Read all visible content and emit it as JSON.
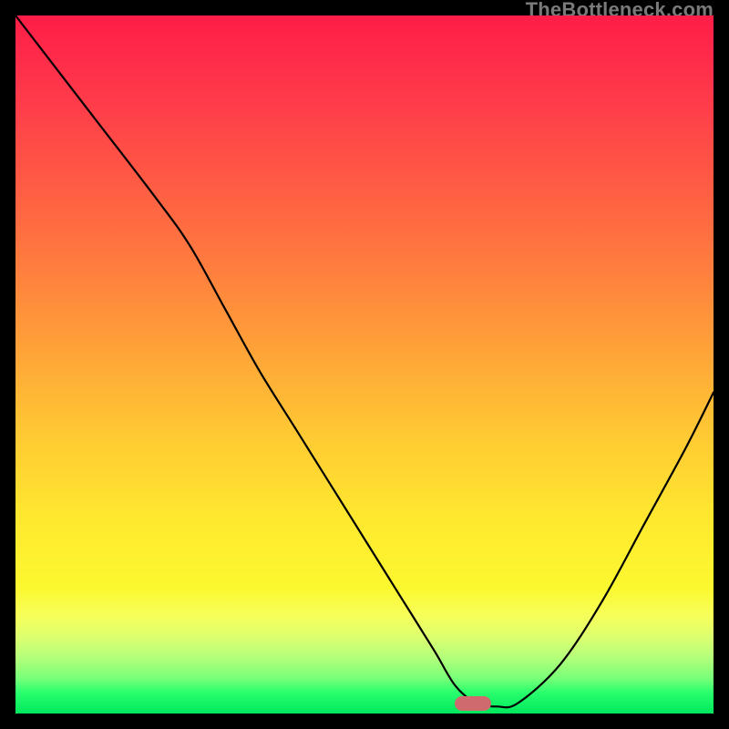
{
  "watermark": "TheBottleneck.com",
  "marker": {
    "x_frac": 0.655,
    "y_frac": 0.985
  },
  "chart_data": {
    "type": "line",
    "title": "",
    "xlabel": "",
    "ylabel": "",
    "xlim": [
      0,
      1
    ],
    "ylim": [
      0,
      1
    ],
    "series": [
      {
        "name": "bottleneck-curve",
        "x": [
          0.0,
          0.1,
          0.2,
          0.25,
          0.3,
          0.35,
          0.4,
          0.45,
          0.5,
          0.55,
          0.6,
          0.63,
          0.66,
          0.69,
          0.72,
          0.78,
          0.84,
          0.9,
          0.96,
          1.0
        ],
        "y": [
          1.0,
          0.87,
          0.74,
          0.67,
          0.58,
          0.49,
          0.41,
          0.33,
          0.25,
          0.17,
          0.09,
          0.04,
          0.015,
          0.01,
          0.015,
          0.07,
          0.16,
          0.27,
          0.38,
          0.46
        ]
      }
    ],
    "optimum_x": 0.675,
    "background_gradient": {
      "top": "#ff1d48",
      "mid": "#ffe82f",
      "bottom": "#00e75d"
    }
  }
}
